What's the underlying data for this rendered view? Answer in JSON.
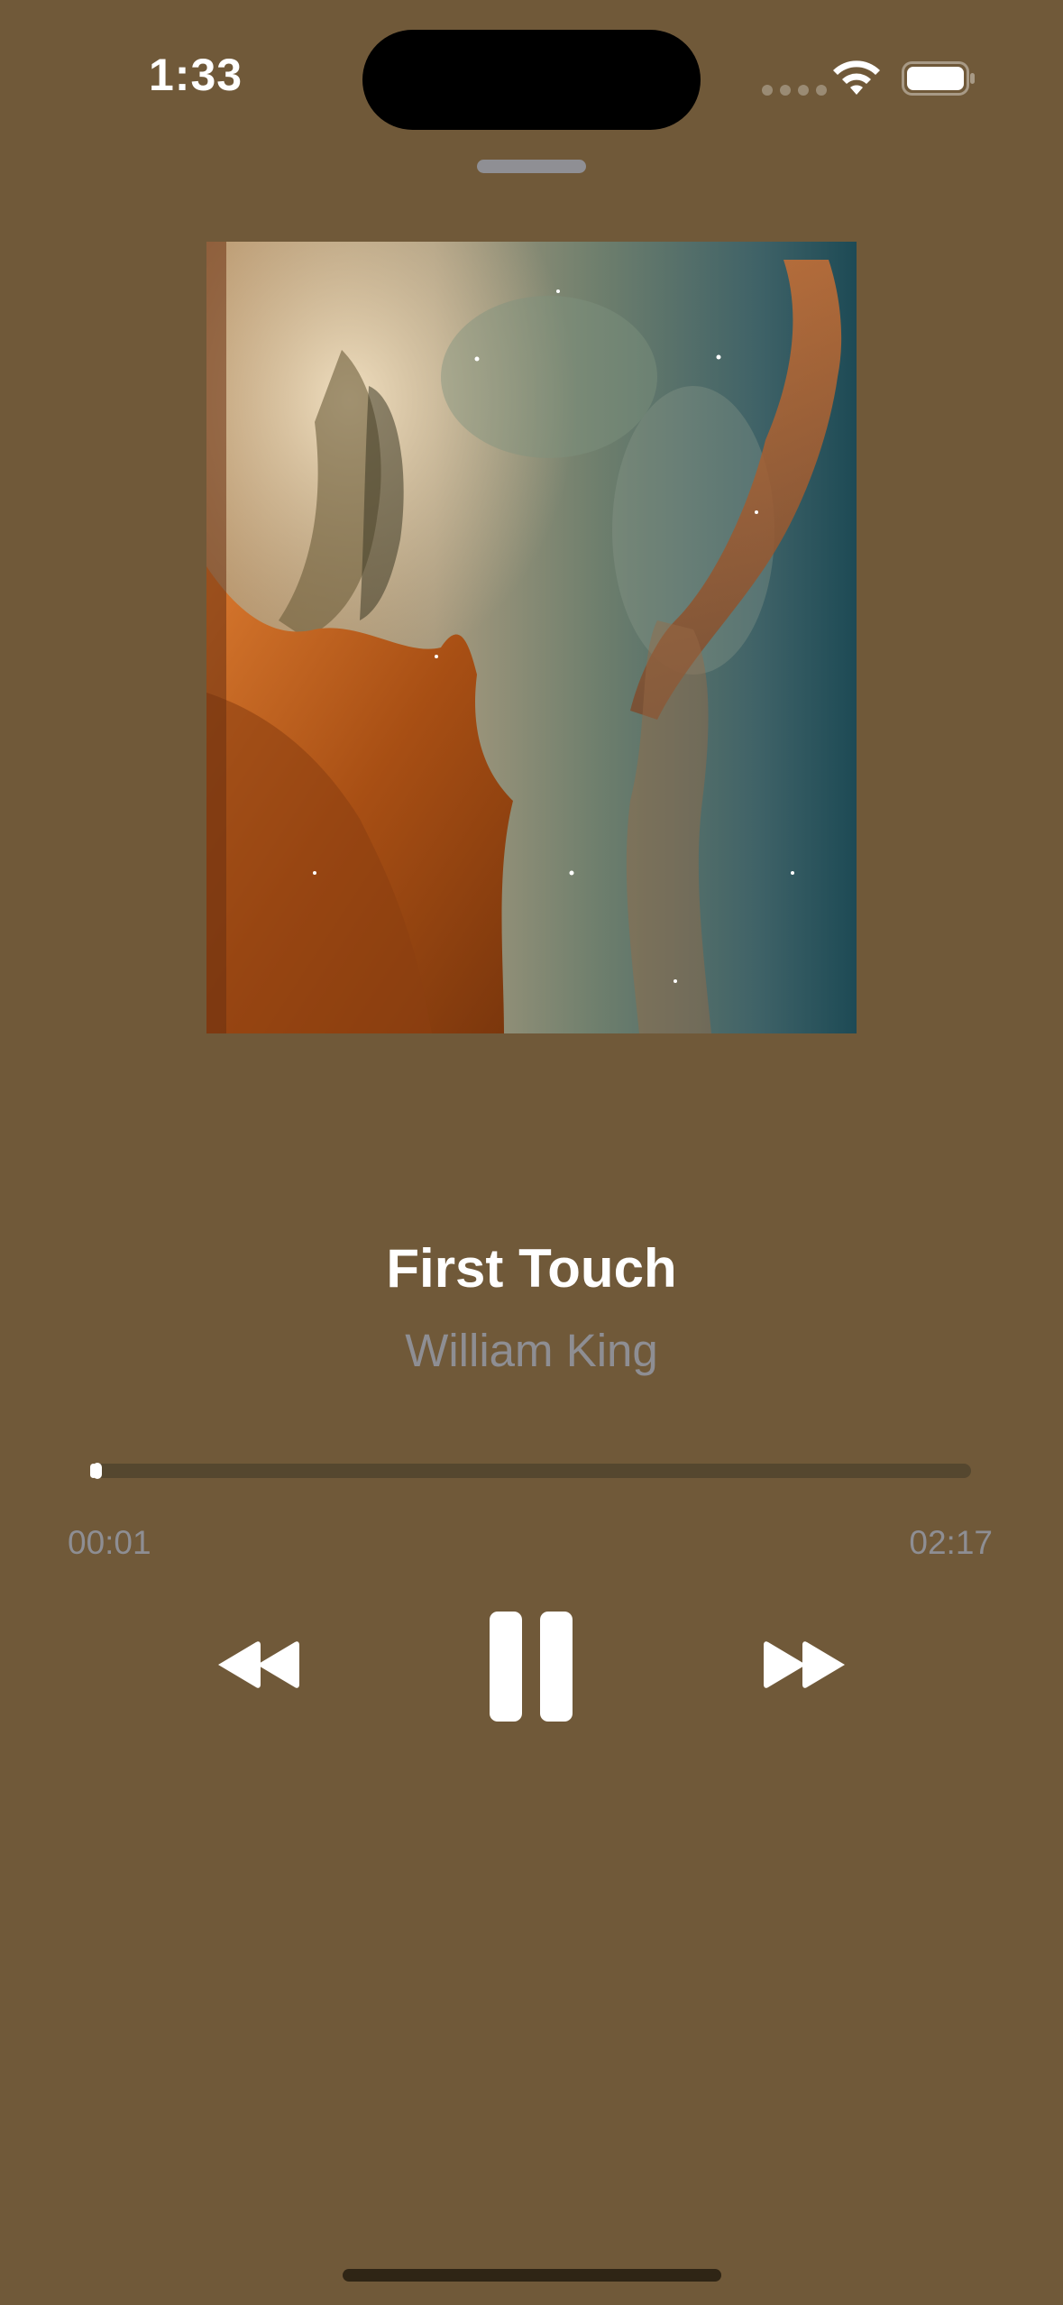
{
  "status_bar": {
    "time": "1:33",
    "wifi_icon": "wifi-icon",
    "battery_icon": "battery-icon",
    "signal_icon": "cellular-dots-icon"
  },
  "player": {
    "background_color": "#705939",
    "artwork_icon": "album-artwork-nebula",
    "title": "First Touch",
    "artist": "William King",
    "elapsed": "00:01",
    "duration": "02:17",
    "progress_fraction": 0.007,
    "controls": {
      "rewind_icon": "rewind-icon",
      "pause_icon": "pause-icon",
      "forward_icon": "fast-forward-icon"
    }
  }
}
